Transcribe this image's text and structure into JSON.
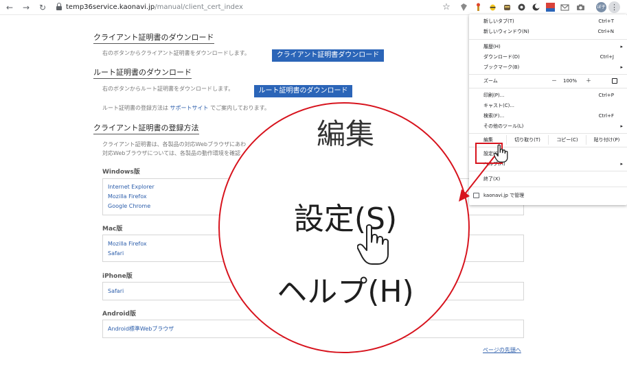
{
  "browser": {
    "back_glyph": "←",
    "forward_glyph": "→",
    "reload_glyph": "↻",
    "url_host": "temp36service.kaonavi.jp",
    "url_path": "/manual/client_cert_index",
    "star_glyph": "☆",
    "avatar_text": "ぼ子",
    "menu_glyph": "⋮",
    "extension_icons": [
      "gem-icon",
      "torch-icon",
      "bee-icon",
      "squirrel-icon",
      "circle-icon",
      "moon-icon",
      "new-badge-icon",
      "mail-icon",
      "camera-icon"
    ]
  },
  "page": {
    "sections": {
      "download": {
        "heading": "クライアント証明書のダウンロード",
        "desc": "右のボタンからクライアント証明書をダウンロードします。",
        "button": "クライアント証明書ダウンロード"
      },
      "root": {
        "heading": "ルート証明書のダウンロード",
        "desc": "右のボタンからルート証明書をダウンロードします。",
        "button": "ルート証明書のダウンロード",
        "note_prefix": "ルート証明書の登録方法は",
        "note_link": "サポートサイト",
        "note_suffix": "でご案内しております。"
      },
      "register": {
        "heading": "クライアント証明書の登録方法",
        "desc_line1": "クライアント証明書は、各製品の対応Webブラウザにあわ",
        "desc_line2": "対応Webブラウザについては、各製品の動作環境を確認"
      }
    },
    "os_groups": [
      {
        "name": "Windows版",
        "browsers": [
          "Internet Explorer",
          "Mozilla Firefox",
          "Google Chrome"
        ]
      },
      {
        "name": "Mac版",
        "browsers": [
          "Mozilla Firefox",
          "Safari"
        ]
      },
      {
        "name": "iPhone版",
        "browsers": [
          "Safari"
        ]
      },
      {
        "name": "Android版",
        "browsers": [
          "Android標準Webブラウザ"
        ]
      }
    ],
    "page_top_link": "ページの先頭へ"
  },
  "menu": {
    "new_tab": {
      "label": "新しいタブ(T)",
      "shortcut": "Ctrl+T"
    },
    "new_window": {
      "label": "新しいウィンドウ(N)",
      "shortcut": "Ctrl+N"
    },
    "history": {
      "label": "履歴(H)"
    },
    "downloads": {
      "label": "ダウンロード(D)",
      "shortcut": "Ctrl+J"
    },
    "bookmarks": {
      "label": "ブックマーク(B)"
    },
    "zoom": {
      "label": "ズーム",
      "minus": "－",
      "value": "100%",
      "plus": "＋"
    },
    "print": {
      "label": "印刷(P)...",
      "shortcut": "Ctrl+P"
    },
    "cast": {
      "label": "キャスト(C)..."
    },
    "find": {
      "label": "検索(F)...",
      "shortcut": "Ctrl+F"
    },
    "more_tools": {
      "label": "その他のツール(L)"
    },
    "edit": {
      "label": "編集",
      "cut": "切り取り(T)",
      "copy": "コピー(C)",
      "paste": "貼り付け(P)"
    },
    "settings": {
      "label": "設定(S)"
    },
    "help": {
      "label": "ヘルプ(H)"
    },
    "exit": {
      "label": "終了(X)"
    },
    "managed": {
      "label": "kaonavi.jp で管理"
    },
    "submenu_arrow": "▸"
  },
  "zoom_callout": {
    "edit": "編集",
    "settings": "設定(S)",
    "help": "ヘルプ(H)"
  },
  "colors": {
    "highlight_red": "#d7131d",
    "button_blue": "#2b65b8",
    "link_blue": "#2a5caa"
  }
}
